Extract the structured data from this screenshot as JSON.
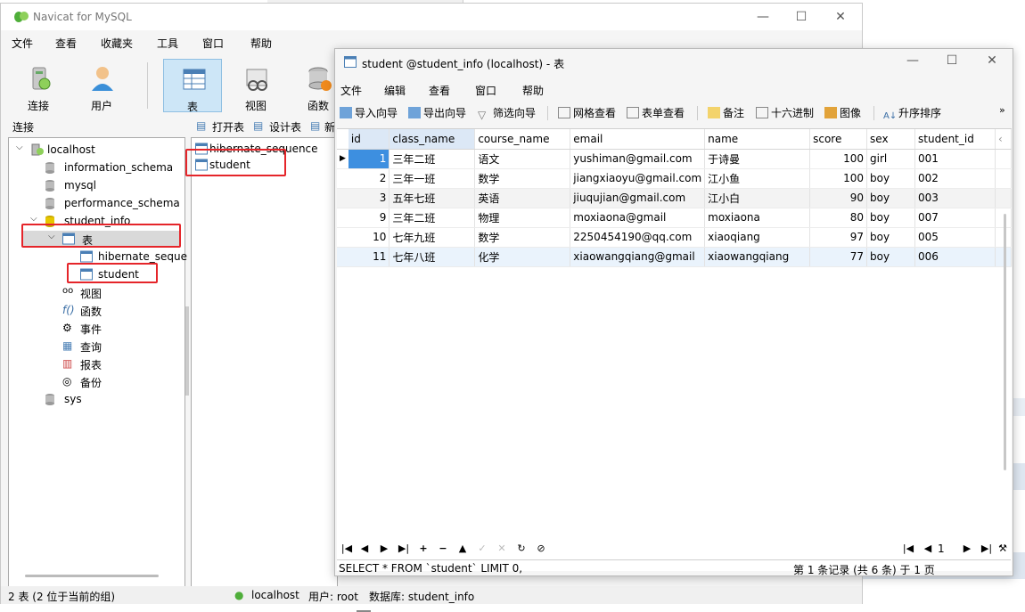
{
  "main_window": {
    "title": "Navicat for MySQL",
    "menu": [
      "文件",
      "查看",
      "收藏夹",
      "工具",
      "窗口",
      "帮助"
    ],
    "toolbar": [
      {
        "label": "连接",
        "icon": "connection-icon"
      },
      {
        "label": "用户",
        "icon": "user-icon"
      },
      {
        "label": "表",
        "icon": "table-icon"
      },
      {
        "label": "视图",
        "icon": "view-icon"
      },
      {
        "label": "函数",
        "icon": "function-icon"
      }
    ],
    "connection_label": "连接",
    "tree": {
      "root": "localhost",
      "databases": [
        "information_schema",
        "mysql",
        "performance_schema",
        "student_info"
      ],
      "table_group": "表",
      "tables": [
        "hibernate_seque",
        "student"
      ],
      "groups": [
        "视图",
        "函数",
        "事件",
        "查询",
        "报表",
        "备份"
      ],
      "last_db": "sys"
    },
    "object_toolbar": {
      "open": "打开表",
      "design": "设计表",
      "new": "新"
    },
    "objects": [
      "hibernate_sequence",
      "student"
    ],
    "status": {
      "tables_count": "2 表 (2 位于当前的组)",
      "connection": "localhost",
      "user": "用户: root",
      "database": "数据库: student_info"
    }
  },
  "table_window": {
    "title": "student @student_info (localhost) - 表",
    "menu": [
      "文件",
      "编辑",
      "查看",
      "窗口",
      "帮助"
    ],
    "toolbar": [
      "导入向导",
      "导出向导",
      "筛选向导",
      "网格查看",
      "表单查看",
      "备注",
      "十六进制",
      "图像",
      "升序排序"
    ],
    "columns": [
      "id",
      "class_name",
      "course_name",
      "email",
      "name",
      "score",
      "sex",
      "student_id"
    ],
    "rows": [
      [
        "1",
        "三年二班",
        "语文",
        "yushiman@gmail.com",
        "于诗曼",
        "100",
        "girl",
        "001"
      ],
      [
        "2",
        "三年一班",
        "数学",
        "jiangxiaoyu@gmail.com",
        "江小鱼",
        "100",
        "boy",
        "002"
      ],
      [
        "3",
        "五年七班",
        "英语",
        "jiuqujian@gmail.com",
        "江小白",
        "90",
        "boy",
        "003"
      ],
      [
        "9",
        "三年二班",
        "物理",
        "moxiaona@gmail",
        "moxiaona",
        "80",
        "boy",
        "007"
      ],
      [
        "10",
        "七年九班",
        "数学",
        "2250454190@qq.com",
        "xiaoqiang",
        "97",
        "boy",
        "005"
      ],
      [
        "11",
        "七年八班",
        "化学",
        "xiaowangqiang@gmail",
        "xiaowangqiang",
        "77",
        "boy",
        "006"
      ]
    ],
    "sql": "SELECT * FROM `student` LIMIT 0,",
    "record_info": "第 1 条记录 (共 6 条) 于 1 页",
    "page_value": "1"
  },
  "colors": {
    "accent": "#3d8fe0",
    "highlight_box": "#e5252a",
    "active_tool": "#cde6f7"
  }
}
